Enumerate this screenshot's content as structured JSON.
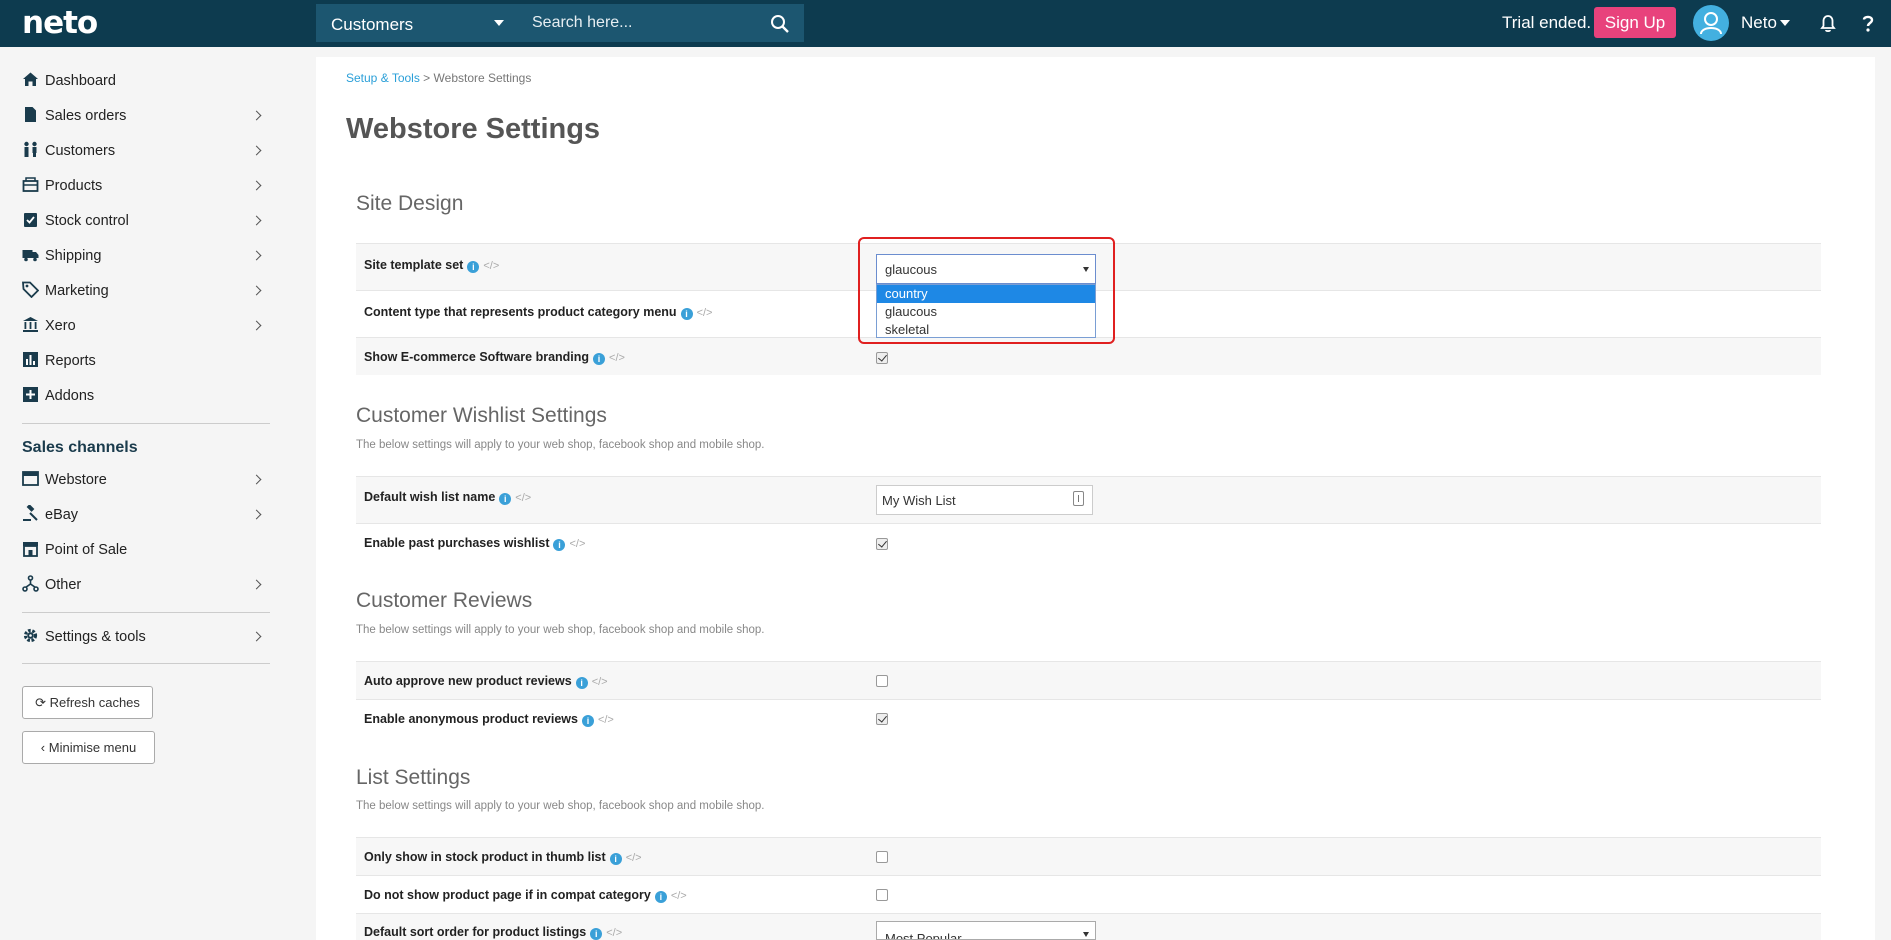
{
  "header": {
    "logo": "neto",
    "search_scope": "Customers",
    "search_placeholder": "Search here...",
    "trial_text": "Trial ended.",
    "signup_label": "Sign Up",
    "user_name": "Neto",
    "icons": [
      "search-icon",
      "user-icon",
      "bell-icon",
      "help-icon"
    ]
  },
  "sidebar": {
    "items": [
      {
        "label": "Dashboard",
        "icon": "home-icon",
        "chevron": false
      },
      {
        "label": "Sales orders",
        "icon": "document-icon",
        "chevron": true
      },
      {
        "label": "Customers",
        "icon": "people-icon",
        "chevron": true
      },
      {
        "label": "Products",
        "icon": "box-icon",
        "chevron": true
      },
      {
        "label": "Stock control",
        "icon": "clipboard-check-icon",
        "chevron": true
      },
      {
        "label": "Shipping",
        "icon": "truck-icon",
        "chevron": true
      },
      {
        "label": "Marketing",
        "icon": "tag-icon",
        "chevron": true
      },
      {
        "label": "Xero",
        "icon": "bank-icon",
        "chevron": true
      },
      {
        "label": "Reports",
        "icon": "bar-chart-icon",
        "chevron": false
      },
      {
        "label": "Addons",
        "icon": "plus-square-icon",
        "chevron": false
      }
    ],
    "channels_heading": "Sales channels",
    "channels": [
      {
        "label": "Webstore",
        "icon": "browser-icon",
        "chevron": true
      },
      {
        "label": "eBay",
        "icon": "gavel-icon",
        "chevron": true
      },
      {
        "label": "Point of Sale",
        "icon": "store-icon",
        "chevron": false
      },
      {
        "label": "Other",
        "icon": "network-icon",
        "chevron": true
      }
    ],
    "settings": {
      "label": "Settings & tools",
      "icon": "gear-icon",
      "chevron": true
    },
    "refresh_label": "Refresh caches",
    "minimise_label": "Minimise menu"
  },
  "breadcrumb": {
    "parent": "Setup & Tools",
    "separator": ">",
    "current": "Webstore Settings"
  },
  "page_title": "Webstore Settings",
  "sections": {
    "site_design": {
      "title": "Site Design",
      "rows": {
        "template": {
          "label": "Site template set",
          "value": "glaucous",
          "options": [
            "country",
            "glaucous",
            "skeletal"
          ],
          "highlighted_option": "country"
        },
        "category_menu": {
          "label": "Content type that represents product category menu"
        },
        "branding": {
          "label": "Show E-commerce Software branding",
          "checked": true
        }
      }
    },
    "wishlist": {
      "title": "Customer Wishlist Settings",
      "desc": "The below settings will apply to your web shop, facebook shop and mobile shop.",
      "rows": {
        "name": {
          "label": "Default wish list name",
          "value": "My Wish List"
        },
        "past": {
          "label": "Enable past purchases wishlist",
          "checked": true
        }
      }
    },
    "reviews": {
      "title": "Customer Reviews",
      "desc": "The below settings will apply to your web shop, facebook shop and mobile shop.",
      "rows": {
        "auto": {
          "label": "Auto approve new product reviews",
          "checked": false
        },
        "anon": {
          "label": "Enable anonymous product reviews",
          "checked": true
        }
      }
    },
    "lists": {
      "title": "List Settings",
      "desc": "The below settings will apply to your web shop, facebook shop and mobile shop.",
      "rows": {
        "instock": {
          "label": "Only show in stock product in thumb list",
          "checked": false
        },
        "compat": {
          "label": "Do not show product page if in compat category",
          "checked": false
        },
        "sort": {
          "label": "Default sort order for product listings",
          "value": "Most Popular"
        }
      }
    }
  },
  "info_glyph": "i",
  "code_glyph": "</>"
}
